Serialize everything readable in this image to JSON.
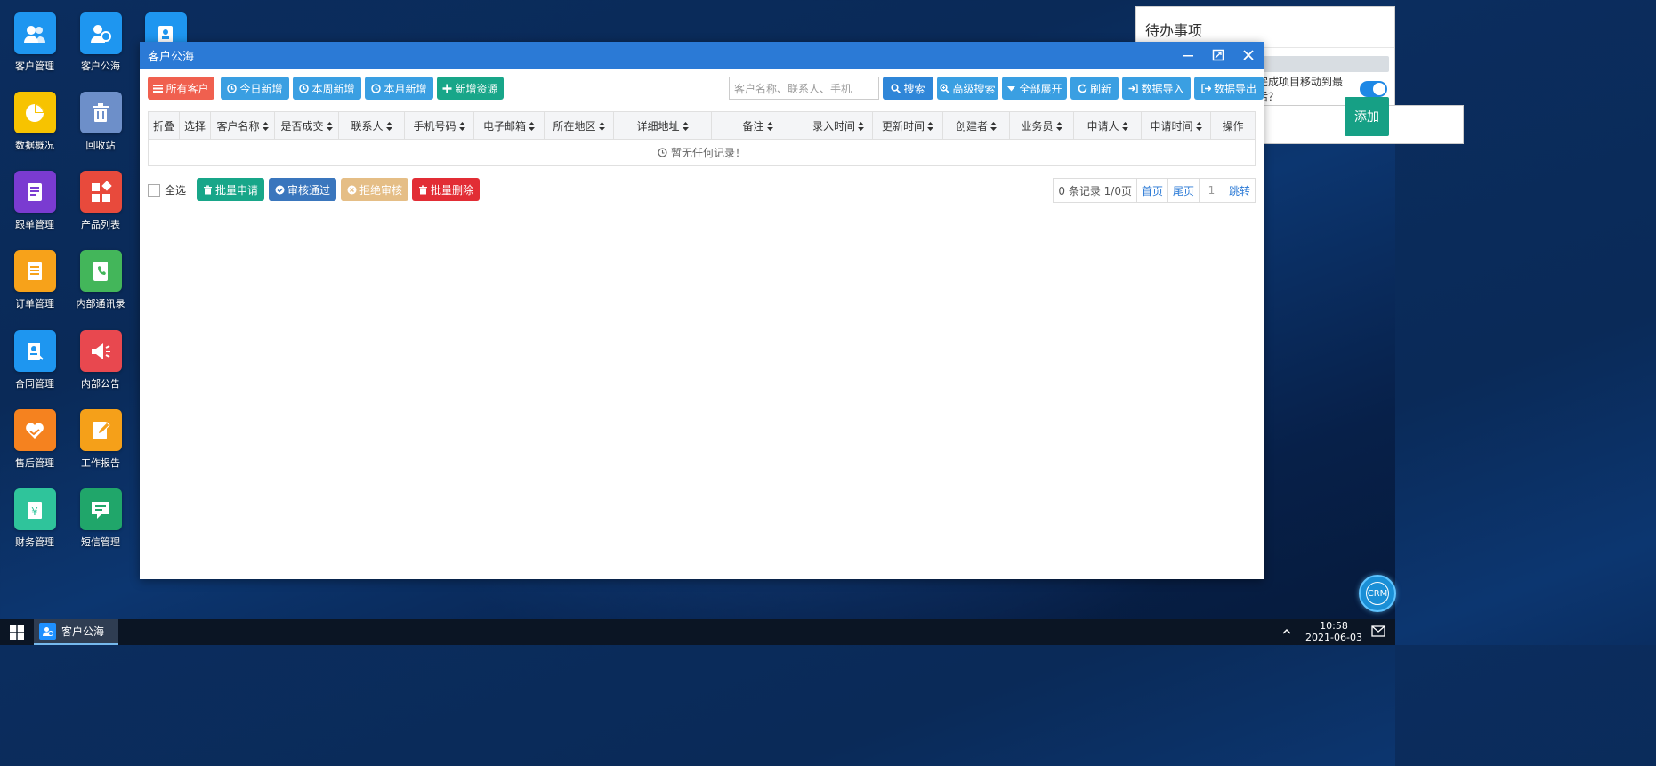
{
  "desktop": {
    "icons": [
      {
        "label": "客户管理",
        "icon": "customers-icon",
        "color": "#1e96f0"
      },
      {
        "label": "客户公海",
        "icon": "customer-pool-icon",
        "color": "#1e96f0"
      },
      {
        "label": "",
        "icon": "id-card-icon",
        "color": "#1e96f0"
      },
      {
        "label": "数据概况",
        "icon": "pie-chart-icon",
        "color": "#f7c300"
      },
      {
        "label": "回收站",
        "icon": "trash-icon",
        "color": "#6d8fc9"
      },
      {
        "label": "跟单管理",
        "icon": "notebook-icon",
        "color": "#7a3bd1"
      },
      {
        "label": "产品列表",
        "icon": "grid-shapes-icon",
        "color": "#e84a3c"
      },
      {
        "label": "订单管理",
        "icon": "document-icon",
        "color": "#f7a21a"
      },
      {
        "label": "内部通讯录",
        "icon": "phone-book-icon",
        "color": "#43b65a"
      },
      {
        "label": "合同管理",
        "icon": "contract-icon",
        "color": "#1e96f0"
      },
      {
        "label": "内部公告",
        "icon": "megaphone-icon",
        "color": "#e8484f"
      },
      {
        "label": "售后管理",
        "icon": "heart-hand-icon",
        "color": "#f5821f"
      },
      {
        "label": "工作报告",
        "icon": "report-pen-icon",
        "color": "#f5a019"
      },
      {
        "label": "财务管理",
        "icon": "finance-icon",
        "color": "#2fc49b"
      },
      {
        "label": "短信管理",
        "icon": "sms-icon",
        "color": "#20a66a"
      }
    ]
  },
  "todo": {
    "title": "待办事项",
    "toggle_label": "完成项目移动到最后？",
    "add_label": "添加"
  },
  "window": {
    "title": "客户公海",
    "toolbar": {
      "all_customers": "所有客户",
      "today_new": "今日新增",
      "week_new": "本周新增",
      "month_new": "本月新增",
      "add_resource": "新增资源",
      "search_placeholder": "客户名称、联系人、手机",
      "search": "搜索",
      "advanced_search": "高级搜索",
      "expand_all": "全部展开",
      "refresh": "刷新",
      "import": "数据导入",
      "export": "数据导出"
    },
    "columns": [
      "折叠",
      "选择",
      "客户名称",
      "是否成交",
      "联系人",
      "手机号码",
      "电子邮箱",
      "所在地区",
      "详细地址",
      "备注",
      "录入时间",
      "更新时间",
      "创建者",
      "业务员",
      "申请人",
      "申请时间",
      "操作"
    ],
    "empty_text": "暂无任何记录！",
    "footer": {
      "select_all": "全选",
      "batch_apply": "批量申请",
      "approve": "审核通过",
      "reject": "拒绝审核",
      "batch_delete": "批量删除"
    },
    "pager": {
      "info": "0 条记录 1/0页",
      "first": "首页",
      "last": "尾页",
      "page_num": "1",
      "jump": "跳转"
    }
  },
  "taskbar": {
    "task_label": "客户公海",
    "time": "10:58",
    "date": "2021-06-03"
  },
  "crm_badge": "CRM"
}
